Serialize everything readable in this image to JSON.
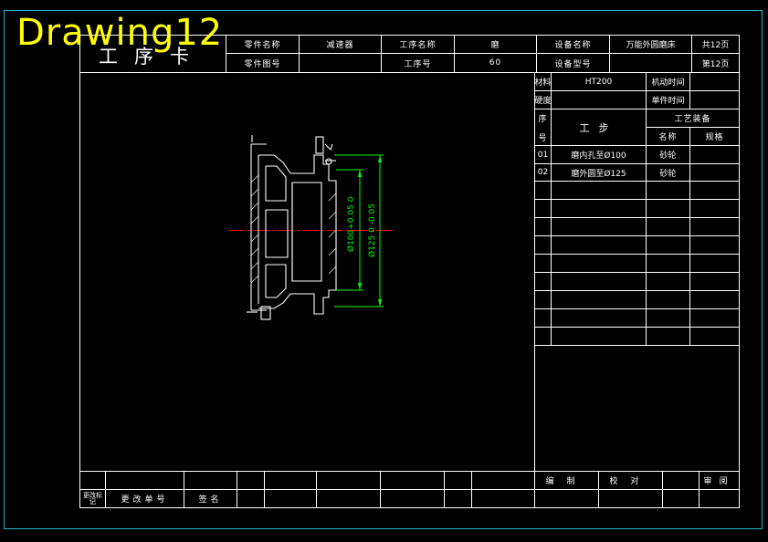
{
  "drawing_name": "Drawing12",
  "sheet_title": "工序卡",
  "header": {
    "part_name_label": "零件名称",
    "part_name": "减速器",
    "part_no_label": "零件图号",
    "part_no": "",
    "op_name_label": "工序名称",
    "op_name": "磨",
    "op_no_label": "工序号",
    "op_no": "60",
    "equip_name_label": "设备名称",
    "equip_name": "万能外圆磨床",
    "equip_model_label": "设备型号",
    "equip_model": "",
    "total_pages": "共12页",
    "page_no": "第12页"
  },
  "info": {
    "material_label": "材料",
    "material": "HT200",
    "machine_time_label": "机动时间",
    "hardness_label": "硬度",
    "hardness": "",
    "unit_time_label": "单件时间"
  },
  "steps_header": {
    "seq_top": "序",
    "seq_bottom": "号",
    "step": "工步",
    "equipment": "工艺装备",
    "equip_name": "名称",
    "equip_spec": "规格"
  },
  "steps": [
    {
      "no": "01",
      "desc": "磨内孔至Ø100",
      "tool": "砂轮"
    },
    {
      "no": "02",
      "desc": "磨外圆至Ø125",
      "tool": "砂轮"
    }
  ],
  "dims": {
    "inner": "Ø100+0.05 0",
    "outer": "Ø125 0 -0.05"
  },
  "footer": {
    "change_mark": "更改标记",
    "change_doc": "更改单号",
    "signature": "签名",
    "compile": "编制",
    "check": "校对",
    "review": "审阅"
  },
  "colors": {
    "border": "#1fb8c8",
    "lines": "#ffffff",
    "dimension": "#00ff00",
    "centerline": "#ff0000",
    "title_overlay": "#ffff00"
  }
}
